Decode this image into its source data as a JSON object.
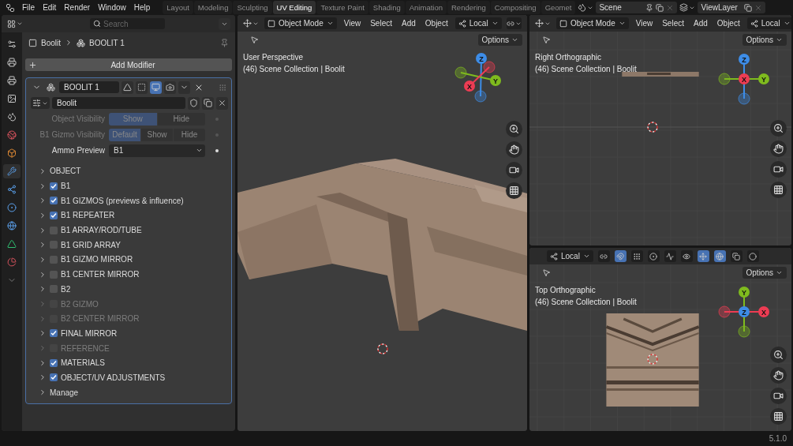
{
  "menu": [
    "File",
    "Edit",
    "Render",
    "Window",
    "Help"
  ],
  "workspaces": [
    {
      "label": "Layout",
      "selected": false
    },
    {
      "label": "Modeling",
      "selected": false
    },
    {
      "label": "Sculpting",
      "selected": false
    },
    {
      "label": "UV Editing",
      "selected": true
    },
    {
      "label": "Texture Paint",
      "selected": false
    },
    {
      "label": "Shading",
      "selected": false
    },
    {
      "label": "Animation",
      "selected": false
    },
    {
      "label": "Rendering",
      "selected": false
    },
    {
      "label": "Compositing",
      "selected": false
    },
    {
      "label": "Geomet",
      "selected": false
    }
  ],
  "scene": {
    "name": "Scene"
  },
  "view_layer": {
    "name": "ViewLayer"
  },
  "properties": {
    "search": {
      "placeholder": "Search"
    },
    "breadcrumb": [
      "Boolit",
      "BOOLIT 1"
    ],
    "add_modifier": "Add Modifier",
    "modifier": {
      "name": "BOOLIT 1",
      "expanded": true,
      "toggles": [
        {
          "kind": "on_cage",
          "selected": false
        },
        {
          "kind": "edit_mode",
          "selected": false
        },
        {
          "kind": "viewport",
          "selected": true
        },
        {
          "kind": "render",
          "selected": false
        }
      ],
      "node_group": "Boolit",
      "inputs": [
        {
          "kind": "segmented",
          "label": "Object Visibility",
          "disabled": true,
          "options": [
            {
              "label": "Show",
              "selected": true
            },
            {
              "label": "Hide",
              "selected": false
            }
          ]
        },
        {
          "kind": "segmented",
          "label": "B1 Gizmo Visibility",
          "disabled": true,
          "options": [
            {
              "label": "Default",
              "selected": true
            },
            {
              "label": "Show",
              "selected": false
            },
            {
              "label": "Hide",
              "selected": false
            }
          ]
        },
        {
          "kind": "dropdown",
          "label": "Ammo Preview",
          "disabled": false,
          "value": "B1"
        }
      ],
      "panels": [
        {
          "kind": "plain",
          "label": "OBJECT",
          "disabled": false
        },
        {
          "kind": "checkbox",
          "label": "B1",
          "checked": true,
          "disabled": false
        },
        {
          "kind": "checkbox",
          "label": "B1 GIZMOS (previews & influence)",
          "checked": true,
          "disabled": false
        },
        {
          "kind": "checkbox",
          "label": "B1 REPEATER",
          "checked": true,
          "disabled": false
        },
        {
          "kind": "checkbox",
          "label": "B1 ARRAY/ROD/TUBE",
          "checked": false,
          "disabled": false
        },
        {
          "kind": "checkbox",
          "label": "B1 GRID ARRAY",
          "checked": false,
          "disabled": false
        },
        {
          "kind": "checkbox",
          "label": "B1 GIZMO MIRROR",
          "checked": false,
          "disabled": false
        },
        {
          "kind": "checkbox",
          "label": "B1 CENTER MIRROR",
          "checked": false,
          "disabled": false
        },
        {
          "kind": "checkbox",
          "label": "B2",
          "checked": false,
          "disabled": false
        },
        {
          "kind": "checkbox",
          "label": "B2 GIZMO",
          "checked": false,
          "disabled": true
        },
        {
          "kind": "checkbox",
          "label": "B2 CENTER MIRROR",
          "checked": false,
          "disabled": true
        },
        {
          "kind": "checkbox",
          "label": "FINAL MIRROR",
          "checked": true,
          "disabled": false
        },
        {
          "kind": "checkbox",
          "label": "REFERENCE",
          "checked": false,
          "disabled": true
        },
        {
          "kind": "checkbox",
          "label": "MATERIALS",
          "checked": true,
          "disabled": false
        },
        {
          "kind": "checkbox",
          "label": "OBJECT/UV ADJUSTMENTS",
          "checked": true,
          "disabled": false
        },
        {
          "kind": "plain",
          "label": "Manage",
          "disabled": false
        }
      ]
    }
  },
  "viewports": [
    {
      "kind": "perspective",
      "mode": "Object Mode",
      "menus": [
        "View",
        "Select",
        "Add",
        "Object"
      ],
      "orientation": "Local",
      "link_toggle": true,
      "options": "Options",
      "view_name": "User Perspective",
      "collection": "(46) Scene Collection | Boolit",
      "axes": [
        {
          "label": "Z",
          "color": "#3d8de8"
        },
        {
          "label": "Y",
          "color": "#7fbb1e"
        },
        {
          "label": "X",
          "color": "#ed3c53"
        }
      ]
    },
    {
      "kind": "right",
      "mode": "Object Mode",
      "menus": [
        "View",
        "Select",
        "Add",
        "Object"
      ],
      "orientation": "Local",
      "options": "Options",
      "view_name": "Right Orthographic",
      "collection": "(46) Scene Collection | Boolit",
      "axes": [
        {
          "label": "Z",
          "color": "#3d8de8"
        },
        {
          "label": "X",
          "color": "#ed3c53"
        },
        {
          "label": "Y",
          "color": "#7fbb1e"
        }
      ]
    },
    {
      "kind": "top",
      "orientation": "Local",
      "tools": [
        {
          "kind": "link",
          "selected": false
        },
        {
          "kind": "snap",
          "selected": true
        },
        {
          "kind": "snap_target",
          "selected": false
        },
        {
          "kind": "proportional",
          "selected": false
        },
        {
          "kind": "falloff",
          "selected": false
        },
        {
          "kind": "visibility",
          "selected": false
        },
        {
          "kind": "gizmo",
          "selected": true
        },
        {
          "kind": "overlay",
          "selected": true
        },
        {
          "kind": "xray",
          "selected": false
        },
        {
          "kind": "shading",
          "selected": false
        }
      ],
      "options": "Options",
      "view_name": "Top Orthographic",
      "collection": "(46) Scene Collection | Boolit",
      "axes": [
        {
          "label": "Y",
          "color": "#7fbb1e"
        },
        {
          "label": "Z",
          "color": "#3d8de8"
        },
        {
          "label": "X",
          "color": "#ed3c53"
        }
      ]
    }
  ],
  "status_bar": {
    "version": "5.1.0"
  }
}
